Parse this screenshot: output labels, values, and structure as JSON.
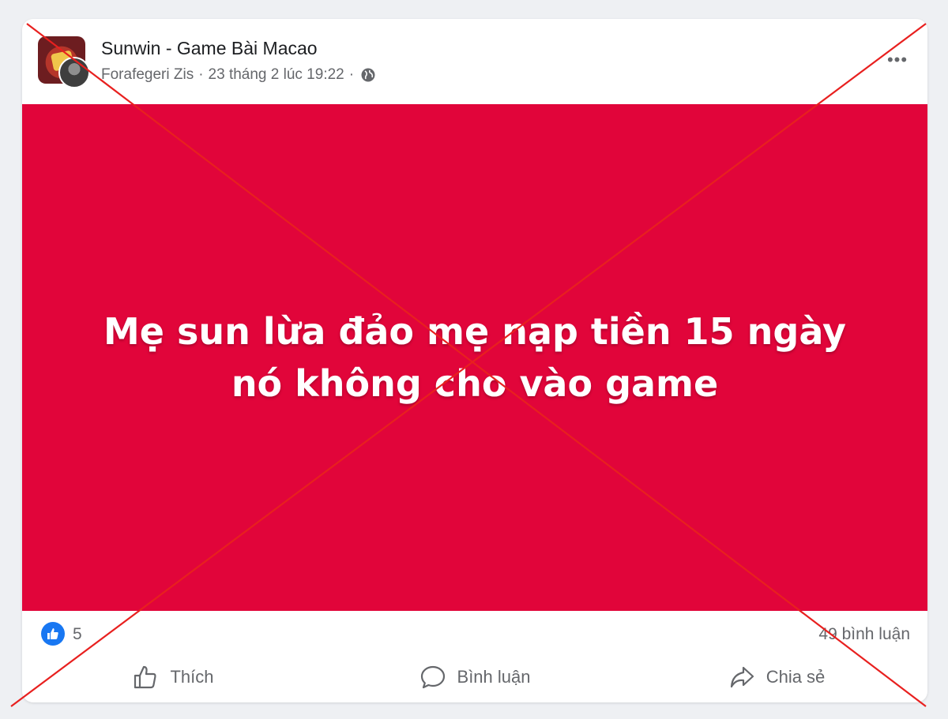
{
  "post": {
    "page_name": "Sunwin - Game Bài Macao",
    "author": "Forafegeri Zis",
    "separator": "·",
    "timestamp": "23 tháng 2 lúc 19:22",
    "privacy_icon": "globe-icon",
    "more_icon": "more-options-icon",
    "more_label": "•••",
    "image_background": "#e1053a",
    "image_text": "Mẹ sun lừa đảo mẹ nạp tiền 15 ngày nó không cho vào game"
  },
  "stats": {
    "like_icon": "like-reaction-icon",
    "like_count": "5",
    "comment_count": "49 bình luận"
  },
  "actions": [
    {
      "icon": "thumbs-up-icon",
      "label": "Thích"
    },
    {
      "icon": "comment-bubble-icon",
      "label": "Bình luận"
    },
    {
      "icon": "share-arrow-icon",
      "label": "Chia sẻ"
    }
  ],
  "overlay": {
    "cross_color": "#e8201f"
  },
  "colors": {
    "facebook_blue": "#1877f2",
    "muted_text": "#65676b"
  }
}
